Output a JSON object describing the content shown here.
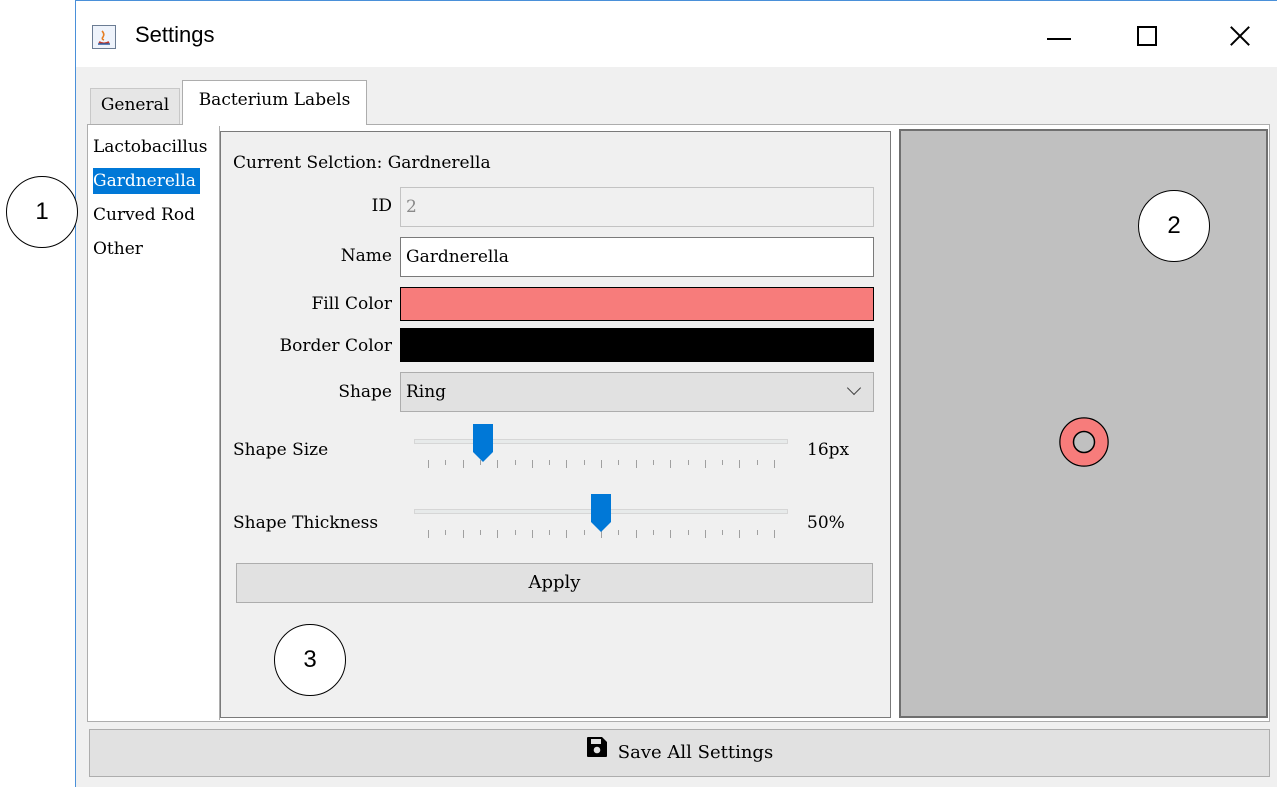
{
  "window": {
    "title": "Settings"
  },
  "tabs": [
    {
      "label": "General",
      "active": false
    },
    {
      "label": "Bacterium Labels",
      "active": true
    }
  ],
  "list": {
    "items": [
      "Lactobacillus",
      "Gardnerella",
      "Curved Rod",
      "Other"
    ],
    "selected_index": 1
  },
  "form": {
    "current_selection": "Current Selction: Gardnerella",
    "id_label": "ID",
    "id_value": "2",
    "name_label": "Name",
    "name_value": "Gardnerella",
    "fill_color_label": "Fill Color",
    "fill_color": "#f77c7b",
    "border_color_label": "Border Color",
    "border_color": "#000000",
    "shape_label": "Shape",
    "shape_value": "Ring",
    "shape_size_label": "Shape Size",
    "shape_size_value": "16px",
    "shape_size_fraction": 0.16,
    "shape_thickness_label": "Shape Thickness",
    "shape_thickness_value": "50%",
    "shape_thickness_fraction": 0.5,
    "apply_label": "Apply"
  },
  "preview": {
    "shape": "ring",
    "fill": "#f77c7b",
    "border": "#000000"
  },
  "footer": {
    "save_all_label": "Save All Settings",
    "icon": "floppy-disk-icon"
  },
  "annotations": [
    "1",
    "2",
    "3"
  ],
  "colors": {
    "selection": "#0078d7",
    "slider_accent": "#0078d7",
    "preview_bg": "#c0c0c0"
  }
}
